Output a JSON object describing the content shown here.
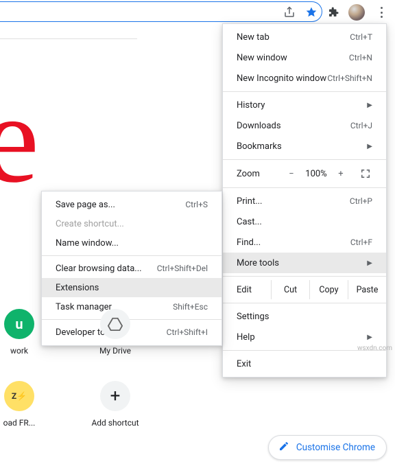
{
  "toolbar": {
    "share_icon": "share-icon",
    "star_icon": "bookmark-star-icon",
    "puzzle_icon": "extensions-icon",
    "avatar": "profile-avatar",
    "menu_icon": "kebab-menu-icon"
  },
  "bg_letter": "e",
  "main_menu": {
    "new_tab": {
      "label": "New tab",
      "shortcut": "Ctrl+T"
    },
    "new_window": {
      "label": "New window",
      "shortcut": "Ctrl+N"
    },
    "new_incognito": {
      "label": "New Incognito window",
      "shortcut": "Ctrl+Shift+N"
    },
    "history": {
      "label": "History"
    },
    "downloads": {
      "label": "Downloads",
      "shortcut": "Ctrl+J"
    },
    "bookmarks": {
      "label": "Bookmarks"
    },
    "zoom": {
      "label": "Zoom",
      "minus": "−",
      "value": "100%",
      "plus": "+"
    },
    "print": {
      "label": "Print...",
      "shortcut": "Ctrl+P"
    },
    "cast": {
      "label": "Cast..."
    },
    "find": {
      "label": "Find...",
      "shortcut": "Ctrl+F"
    },
    "more_tools": {
      "label": "More tools"
    },
    "edit": {
      "label": "Edit",
      "cut": "Cut",
      "copy": "Copy",
      "paste": "Paste"
    },
    "settings": {
      "label": "Settings"
    },
    "help": {
      "label": "Help"
    },
    "exit": {
      "label": "Exit"
    }
  },
  "sub_menu": {
    "save_page": {
      "label": "Save page as...",
      "shortcut": "Ctrl+S"
    },
    "create_shortcut": {
      "label": "Create shortcut..."
    },
    "name_window": {
      "label": "Name window..."
    },
    "clear_data": {
      "label": "Clear browsing data...",
      "shortcut": "Ctrl+Shift+Del"
    },
    "extensions": {
      "label": "Extensions"
    },
    "task_manager": {
      "label": "Task manager",
      "shortcut": "Shift+Esc"
    },
    "dev_tools": {
      "label": "Developer tools",
      "shortcut": "Ctrl+Shift+I"
    }
  },
  "shortcuts": {
    "s1": "work",
    "s2": "My Drive",
    "s3": "oad FR...",
    "s4": "Add shortcut"
  },
  "customise": "Customise Chrome",
  "watermark": "wsxdn.com"
}
